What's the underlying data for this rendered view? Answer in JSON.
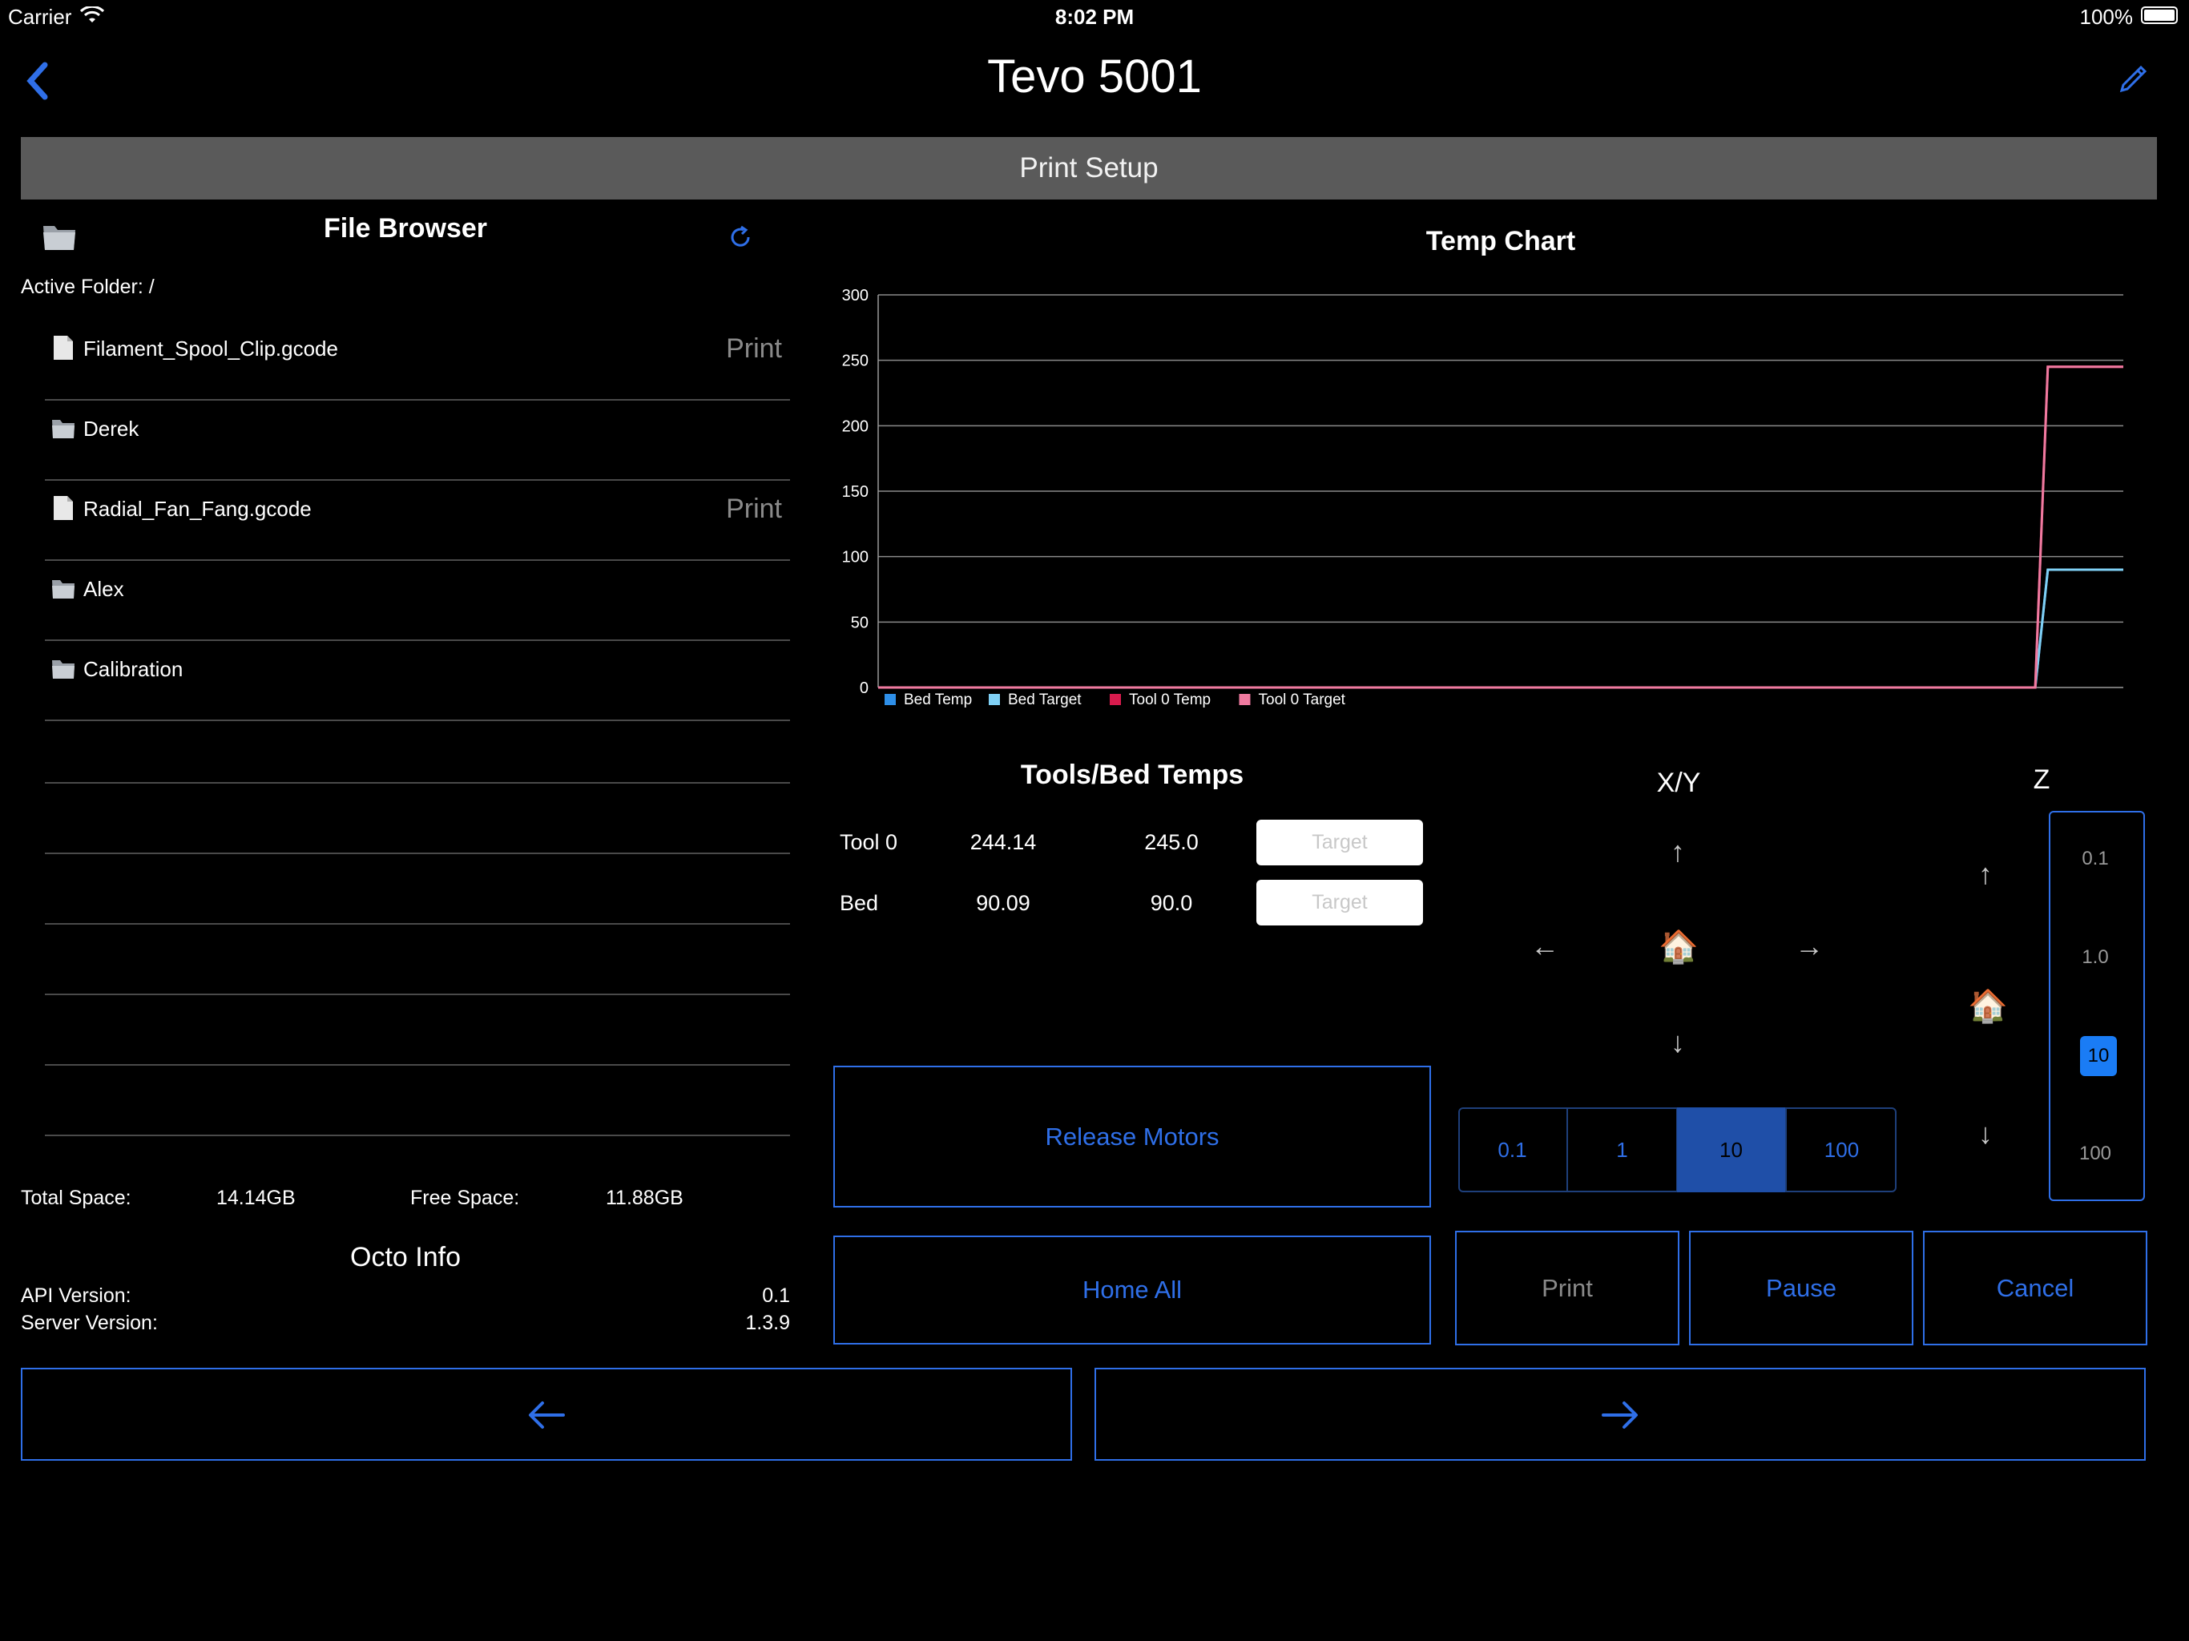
{
  "status": {
    "carrier": "Carrier",
    "time": "8:02 PM",
    "battery": "100%"
  },
  "nav": {
    "title": "Tevo 5001",
    "back_icon": "chevron-left-icon",
    "edit_icon": "pencil-icon"
  },
  "section_title": "Print Setup",
  "file_browser": {
    "title": "File Browser",
    "active_folder_label": "Active Folder: /",
    "files": [
      {
        "name": "Filament_Spool_Clip.gcode",
        "type": "file",
        "action": "Print"
      },
      {
        "name": "Derek",
        "type": "folder",
        "action": ""
      },
      {
        "name": "Radial_Fan_Fang.gcode",
        "type": "file",
        "action": "Print"
      },
      {
        "name": "Alex",
        "type": "folder",
        "action": ""
      },
      {
        "name": "Calibration",
        "type": "folder",
        "action": ""
      }
    ],
    "total_space_label": "Total Space:",
    "total_space": "14.14GB",
    "free_space_label": "Free Space:",
    "free_space": "11.88GB"
  },
  "octo_info": {
    "title": "Octo Info",
    "api_label": "API Version:",
    "api_value": "0.1",
    "server_label": "Server Version:",
    "server_value": "1.3.9"
  },
  "chart_data": {
    "type": "line",
    "title": "Temp Chart",
    "ylim": [
      0,
      300
    ],
    "yticks": [
      "300",
      "250",
      "200",
      "150",
      "100",
      "50",
      "0"
    ],
    "x_samples": 100,
    "step_at": 93,
    "series": [
      {
        "name": "Bed Temp",
        "color": "#2e8fe8",
        "before": 0,
        "after": 90
      },
      {
        "name": "Bed Target",
        "color": "#7fd0f5",
        "before": 0,
        "after": 90
      },
      {
        "name": "Tool 0 Temp",
        "color": "#d81b4d",
        "before": 0,
        "after": 245
      },
      {
        "name": "Tool 0 Target",
        "color": "#f07aa0",
        "before": 0,
        "after": 245
      }
    ]
  },
  "temps": {
    "title": "Tools/Bed Temps",
    "rows": [
      {
        "label": "Tool 0",
        "actual": "244.14",
        "target": "245.0",
        "button": "Target"
      },
      {
        "label": "Bed",
        "actual": "90.09",
        "target": "90.0",
        "button": "Target"
      }
    ]
  },
  "buttons": {
    "release_motors": "Release Motors",
    "home_all": "Home All",
    "print": "Print",
    "pause": "Pause",
    "cancel": "Cancel"
  },
  "xy": {
    "title": "X/Y",
    "home_icon": "🏠",
    "steps": [
      "0.1",
      "1",
      "10",
      "100"
    ],
    "selected_step": "10"
  },
  "z": {
    "title": "Z",
    "home_icon": "🏠",
    "steps": [
      "0.1",
      "1.0",
      "10",
      "100"
    ],
    "selected_step": "10"
  },
  "bottom_nav": {
    "prev_icon": "arrow-left-icon",
    "next_icon": "arrow-right-icon"
  },
  "colors": {
    "accent": "#2f6fe8",
    "section_bar": "#5a5a5a",
    "selected": "#1f4fa8",
    "z_selected": "#1a7cf5"
  }
}
